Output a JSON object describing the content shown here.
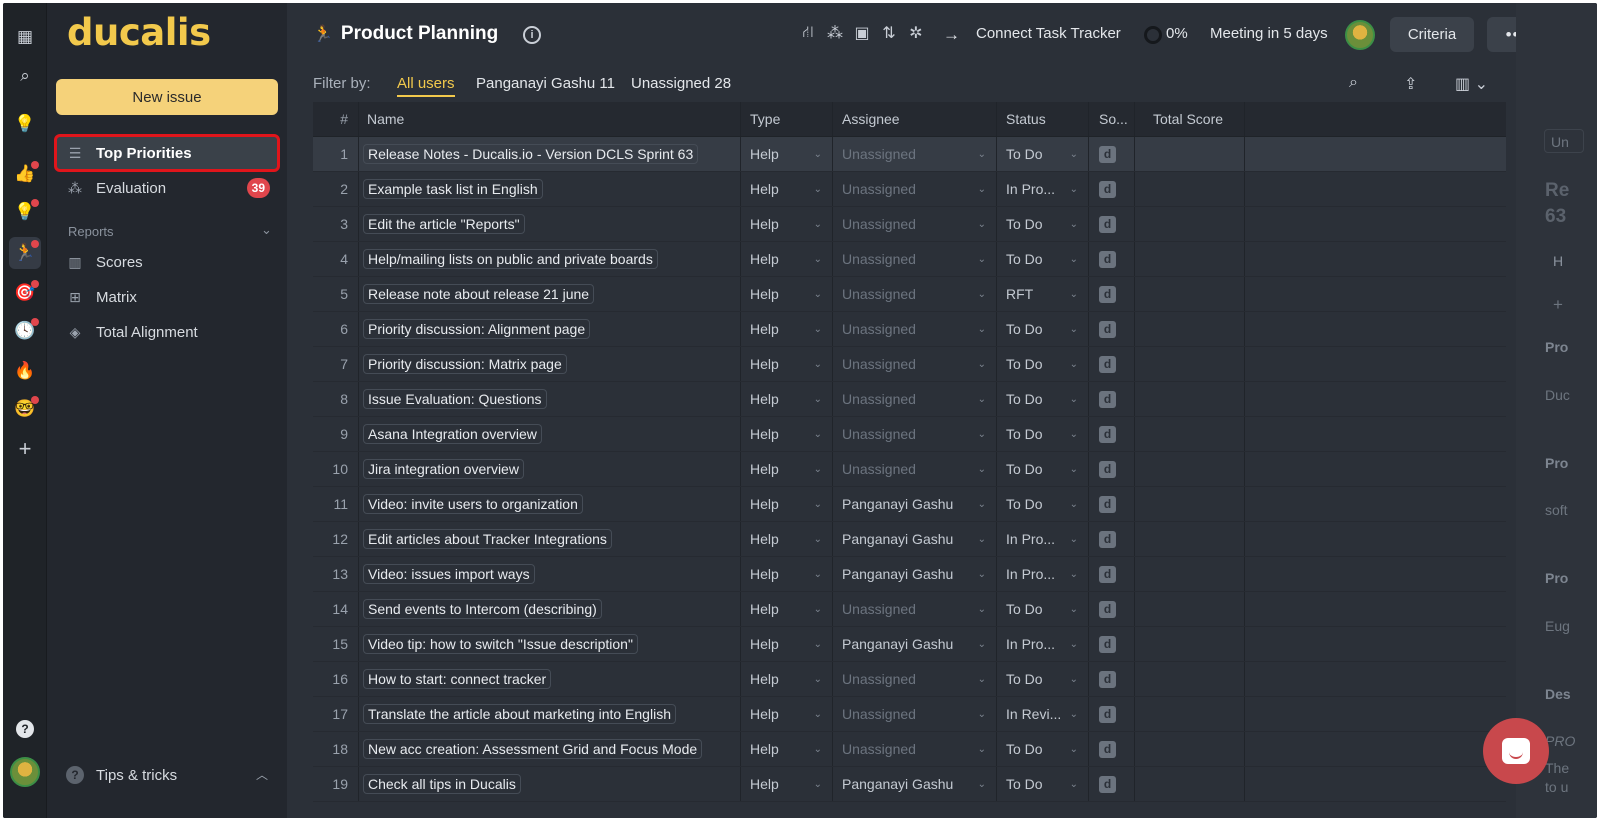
{
  "brand": {
    "logo": "ducalis",
    "accent": "#f2c94c"
  },
  "rail": {
    "icons": [
      "grid-icon",
      "search-icon",
      "bulb-icon",
      "thumbs-up-icon",
      "bulb-icon",
      "runner-icon",
      "target-icon",
      "clock-icon",
      "fire-icon",
      "face-icon",
      "plus-icon",
      "help-icon",
      "avatar"
    ]
  },
  "sidebar": {
    "new_issue": "New issue",
    "items": [
      {
        "label": "Top Priorities",
        "icon": "list-icon"
      },
      {
        "label": "Evaluation",
        "icon": "nodes-icon",
        "badge": "39"
      }
    ],
    "reports_label": "Reports",
    "reports": [
      {
        "label": "Scores",
        "icon": "columns-icon"
      },
      {
        "label": "Matrix",
        "icon": "matrix-icon"
      },
      {
        "label": "Total Alignment",
        "icon": "layers-icon"
      }
    ],
    "tips": "Tips & tricks"
  },
  "header": {
    "title": "Product Planning",
    "connect": "Connect Task Tracker",
    "progress": "0%",
    "meeting": "Meeting in 5 days",
    "criteria": "Criteria",
    "more": "•••"
  },
  "filter": {
    "label": "Filter by:",
    "options": [
      "All users",
      "Panganayi Gashu 11",
      "Unassigned 28"
    ]
  },
  "table": {
    "columns": [
      "#",
      "Name",
      "Type",
      "Assignee",
      "Status",
      "So...",
      "Total Score"
    ],
    "rows": [
      {
        "n": "1",
        "name": "Release Notes - Ducalis.io - Version DCLS Sprint 63",
        "type": "Help",
        "assignee": "Unassigned",
        "status": "To Do"
      },
      {
        "n": "2",
        "name": "Example task list in English",
        "type": "Help",
        "assignee": "Unassigned",
        "status": "In Pro..."
      },
      {
        "n": "3",
        "name": "Edit the article \"Reports\"",
        "type": "Help",
        "assignee": "Unassigned",
        "status": "To Do"
      },
      {
        "n": "4",
        "name": "Help/mailing lists on public and private boards",
        "type": "Help",
        "assignee": "Unassigned",
        "status": "To Do"
      },
      {
        "n": "5",
        "name": "Release note about release 21 june",
        "type": "Help",
        "assignee": "Unassigned",
        "status": "RFT"
      },
      {
        "n": "6",
        "name": "Priority discussion: Alignment page",
        "type": "Help",
        "assignee": "Unassigned",
        "status": "To Do"
      },
      {
        "n": "7",
        "name": "Priority discussion: Matrix page",
        "type": "Help",
        "assignee": "Unassigned",
        "status": "To Do"
      },
      {
        "n": "8",
        "name": "Issue Evaluation: Questions",
        "type": "Help",
        "assignee": "Unassigned",
        "status": "To Do"
      },
      {
        "n": "9",
        "name": "Asana Integration overview",
        "type": "Help",
        "assignee": "Unassigned",
        "status": "To Do"
      },
      {
        "n": "10",
        "name": "Jira integration overview",
        "type": "Help",
        "assignee": "Unassigned",
        "status": "To Do"
      },
      {
        "n": "11",
        "name": "Video: invite users to organization",
        "type": "Help",
        "assignee": "Panganayi Gashu",
        "status": "To Do"
      },
      {
        "n": "12",
        "name": "Edit articles about Tracker Integrations",
        "type": "Help",
        "assignee": "Panganayi Gashu",
        "status": "In Pro..."
      },
      {
        "n": "13",
        "name": "Video: issues import ways",
        "type": "Help",
        "assignee": "Panganayi Gashu",
        "status": "In Pro..."
      },
      {
        "n": "14",
        "name": "Send events to Intercom (describing)",
        "type": "Help",
        "assignee": "Unassigned",
        "status": "To Do"
      },
      {
        "n": "15",
        "name": "Video tip: how to switch \"Issue description\"",
        "type": "Help",
        "assignee": "Panganayi Gashu",
        "status": "In Pro..."
      },
      {
        "n": "16",
        "name": "How to start: connect tracker",
        "type": "Help",
        "assignee": "Unassigned",
        "status": "To Do"
      },
      {
        "n": "17",
        "name": "Translate the article about marketing into English",
        "type": "Help",
        "assignee": "Unassigned",
        "status": "In Revi..."
      },
      {
        "n": "18",
        "name": "New acc creation: Assessment Grid and Focus Mode",
        "type": "Help",
        "assignee": "Unassigned",
        "status": "To Do"
      },
      {
        "n": "19",
        "name": "Check all tips in Ducalis",
        "type": "Help",
        "assignee": "Panganayi Gashu",
        "status": "To Do"
      }
    ],
    "source_glyph": "d"
  },
  "right_panel": {
    "snippets": [
      "Un",
      "Re",
      "63",
      "H",
      "+",
      "Pro",
      "Duc",
      "Pro",
      "soft",
      "Pro",
      "Eug",
      "Des",
      "PRO",
      "The",
      "to u"
    ]
  }
}
